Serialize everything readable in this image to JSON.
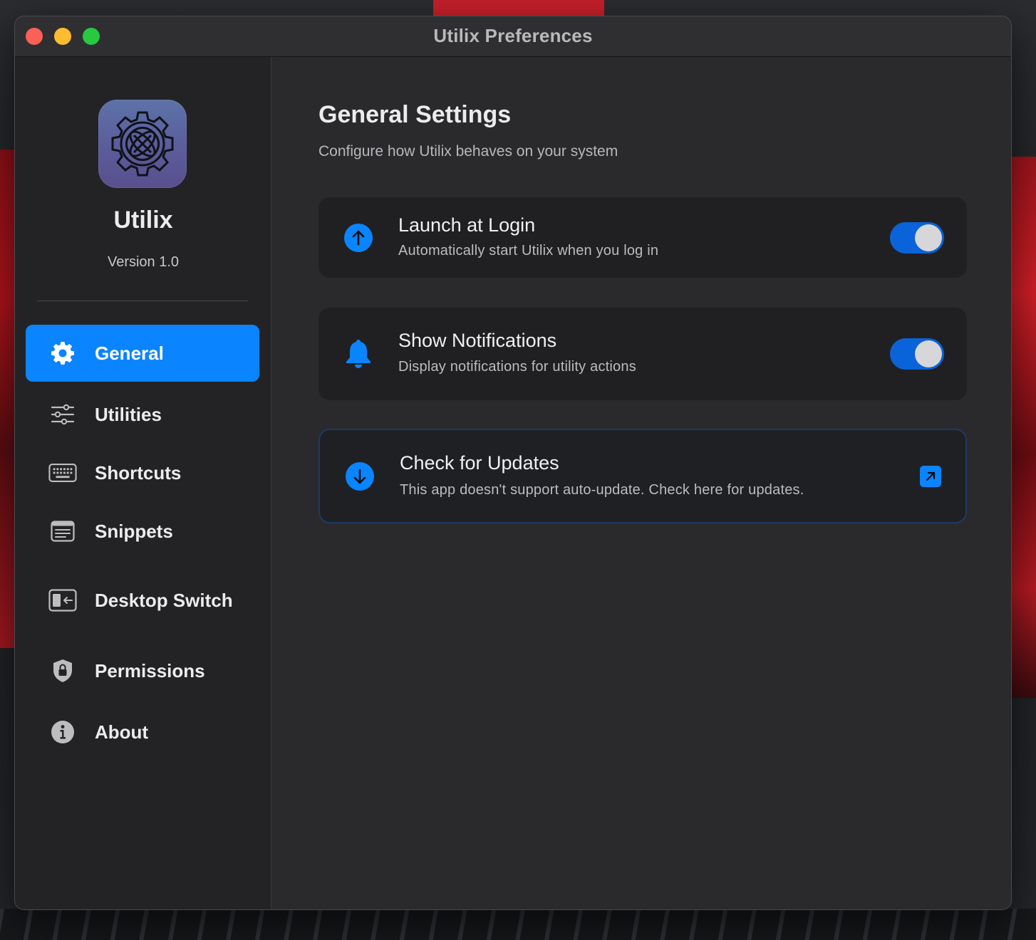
{
  "window": {
    "title": "Utilix Preferences"
  },
  "sidebar": {
    "app_name": "Utilix",
    "version": "Version 1.0",
    "items": [
      {
        "label": "General",
        "icon": "gear-icon",
        "active": true
      },
      {
        "label": "Utilities",
        "icon": "sliders-icon",
        "active": false
      },
      {
        "label": "Shortcuts",
        "icon": "keyboard-icon",
        "active": false
      },
      {
        "label": "Snippets",
        "icon": "document-lines-icon",
        "active": false
      },
      {
        "label": "Desktop Switch",
        "icon": "desktop-switch-icon",
        "active": false
      },
      {
        "label": "Permissions",
        "icon": "shield-lock-icon",
        "active": false
      },
      {
        "label": "About",
        "icon": "info-icon",
        "active": false
      }
    ]
  },
  "main": {
    "title": "General Settings",
    "subtitle": "Configure how Utilix behaves on your system",
    "settings": [
      {
        "title": "Launch at Login",
        "description": "Automatically start Utilix when you log in",
        "icon": "arrow-up-circle-icon",
        "enabled": true
      },
      {
        "title": "Show Notifications",
        "description": "Display notifications for utility actions",
        "icon": "bell-icon",
        "enabled": true
      },
      {
        "title": "Check for Updates",
        "description": "This app doesn't support auto-update. Check here for updates.",
        "icon": "arrow-down-circle-icon",
        "action_icon": "external-link-icon"
      }
    ]
  },
  "colors": {
    "accent": "#0a84ff",
    "window_bg": "#2a2a2d",
    "sidebar_bg": "#232325",
    "card_bg": "#202022",
    "toggle_on": "#0a63d8",
    "close": "#fe5f57",
    "minimize": "#febc2e",
    "maximize": "#28c840"
  }
}
